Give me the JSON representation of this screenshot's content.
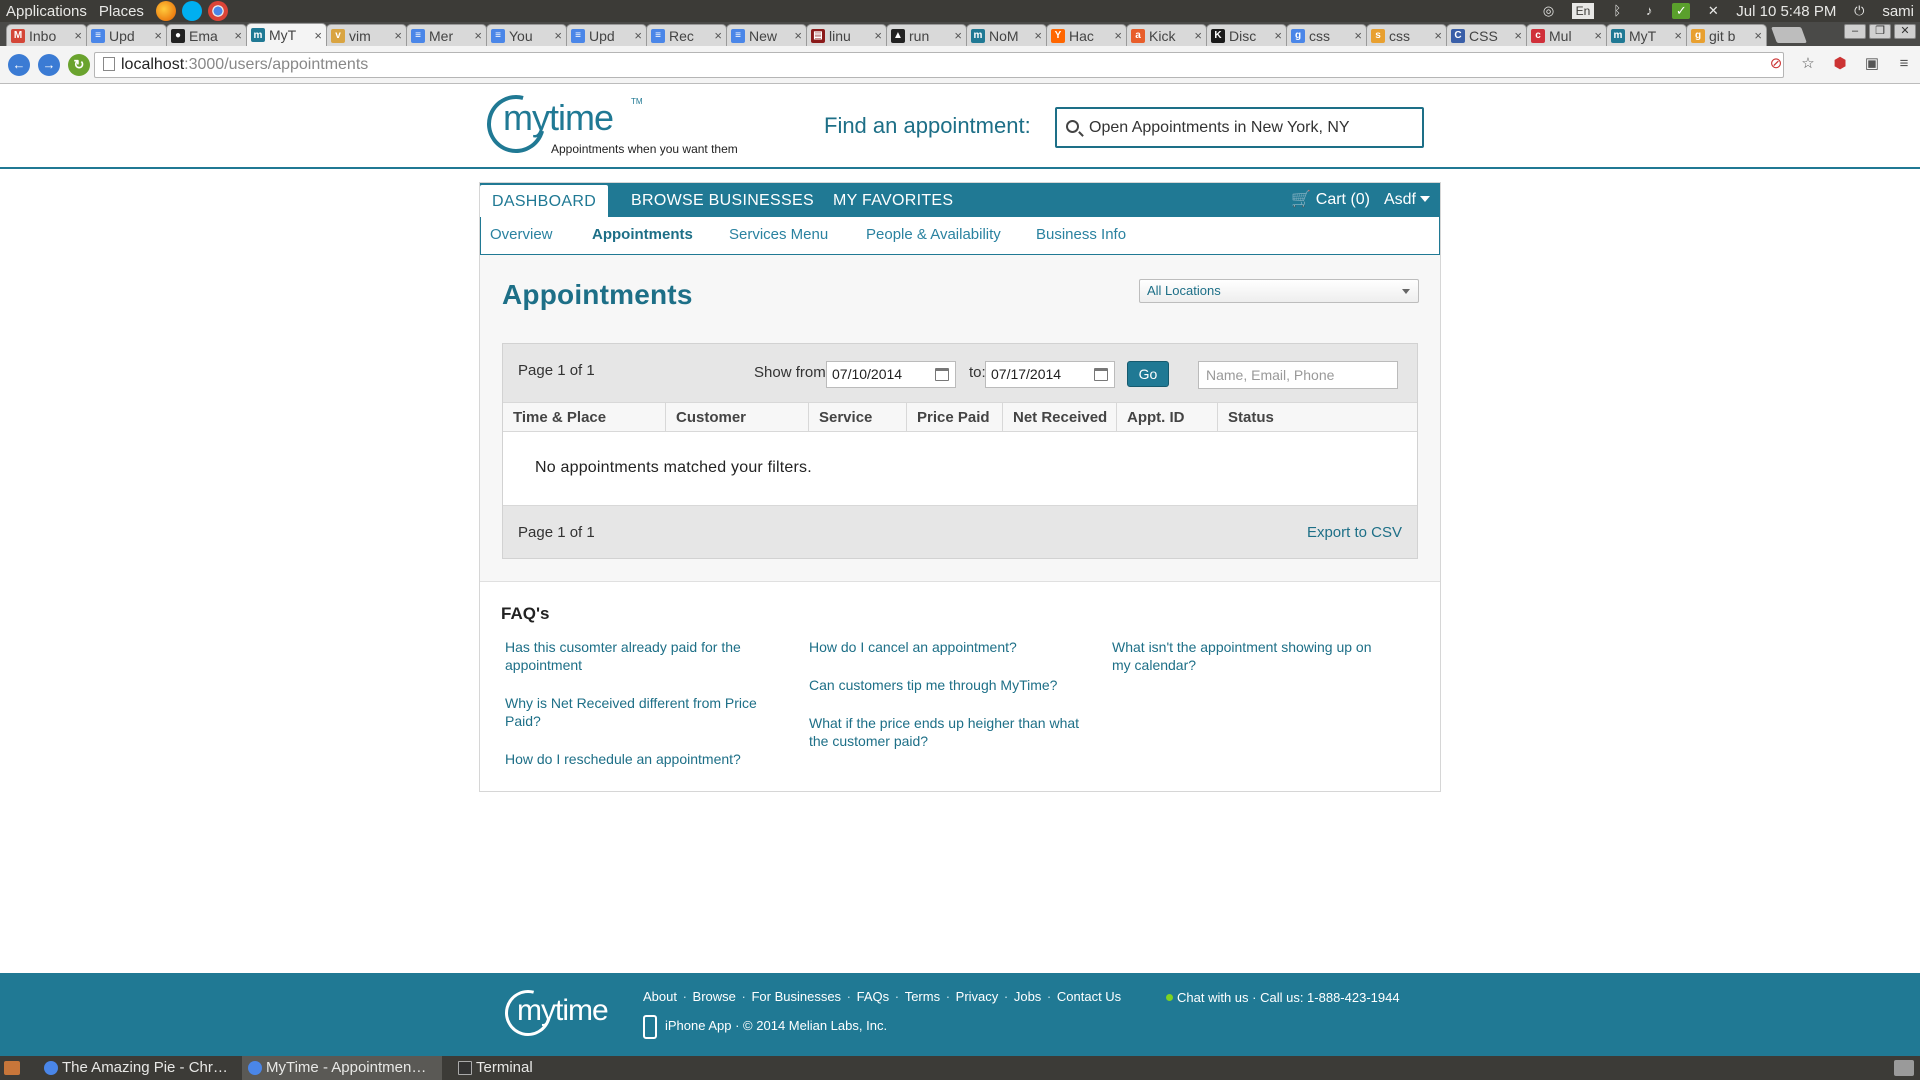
{
  "os": {
    "menu_applications": "Applications",
    "menu_places": "Places",
    "lang": "En",
    "clock": "Jul 10  5:48 PM",
    "user": "sami"
  },
  "browser": {
    "tabs": [
      {
        "label": "Inbo",
        "color": "#d44638",
        "glyph": "M"
      },
      {
        "label": "Upd",
        "color": "#4a86e8",
        "glyph": "≡"
      },
      {
        "label": "Ema",
        "color": "#222222",
        "glyph": "●"
      },
      {
        "label": "MyT",
        "color": "#207994",
        "glyph": "m"
      },
      {
        "label": "vim",
        "color": "#d9a441",
        "glyph": "v"
      },
      {
        "label": "Mer",
        "color": "#4a86e8",
        "glyph": "≡"
      },
      {
        "label": "You",
        "color": "#4a86e8",
        "glyph": "≡"
      },
      {
        "label": "Upd",
        "color": "#4a86e8",
        "glyph": "≡"
      },
      {
        "label": "Rec",
        "color": "#4a86e8",
        "glyph": "≡"
      },
      {
        "label": "New",
        "color": "#4a86e8",
        "glyph": "≡"
      },
      {
        "label": "linu",
        "color": "#8b1a1a",
        "glyph": "▤"
      },
      {
        "label": "run",
        "color": "#222222",
        "glyph": "▲"
      },
      {
        "label": "NoM",
        "color": "#207994",
        "glyph": "m"
      },
      {
        "label": "Hac",
        "color": "#ff6600",
        "glyph": "Y"
      },
      {
        "label": "Kick",
        "color": "#e85d2a",
        "glyph": "a"
      },
      {
        "label": "Disc",
        "color": "#1a1a1a",
        "glyph": "K"
      },
      {
        "label": "css",
        "color": "#4a86e8",
        "glyph": "g"
      },
      {
        "label": "css",
        "color": "#e8a030",
        "glyph": "s"
      },
      {
        "label": "CSS",
        "color": "#3a5fa8",
        "glyph": "C"
      },
      {
        "label": "Mul",
        "color": "#d0303a",
        "glyph": "c"
      },
      {
        "label": "MyT",
        "color": "#207994",
        "glyph": "m"
      },
      {
        "label": "git b",
        "color": "#e8a030",
        "glyph": "g"
      }
    ],
    "active_tab": 3,
    "url_host": "localhost",
    "url_path": ":3000/users/appointments"
  },
  "header": {
    "logo_word": "mytime",
    "logo_tm": "TM",
    "logo_tagline": "Appointments when you want them",
    "find_label": "Find an appointment:",
    "find_value": "Open Appointments in New York, NY"
  },
  "mainnav": {
    "items": [
      "DASHBOARD",
      "BROWSE BUSINESSES",
      "MY FAVORITES"
    ],
    "cart": "Cart (0)",
    "user": "Asdf"
  },
  "subnav": {
    "items": [
      "Overview",
      "Appointments",
      "Services Menu",
      "People & Availability",
      "Business Info"
    ],
    "active": 1
  },
  "appointments": {
    "title": "Appointments",
    "location_select": "All Locations",
    "page_info_top": "Page 1 of 1",
    "show_from_label": "Show from",
    "from_date": "07/10/2014",
    "to_label": "to:",
    "to_date": "07/17/2014",
    "go_label": "Go",
    "search_placeholder": "Name, Email, Phone",
    "columns": [
      "Time & Place",
      "Customer",
      "Service",
      "Price Paid",
      "Net Received",
      "Appt. ID",
      "Status"
    ],
    "empty_message": "No appointments matched your filters.",
    "page_info_bottom": "Page 1 of 1",
    "export_label": "Export to CSV"
  },
  "faq": {
    "title": "FAQ's",
    "col1": [
      "Has this cusomter already paid for the appointment",
      "Why is Net Received different from Price Paid?",
      "How do I reschedule an appointment?"
    ],
    "col2": [
      "How do I cancel an appointment?",
      "Can customers tip me through MyTime?",
      "What if the price ends up heigher than what the customer paid?"
    ],
    "col3": [
      "What isn't the appointment showing up on my calendar?"
    ]
  },
  "footer": {
    "logo_word": "mytime",
    "links": [
      "About",
      "Browse",
      "For Businesses",
      "FAQs",
      "Terms",
      "Privacy",
      "Jobs",
      "Contact Us"
    ],
    "app_line": "iPhone App · © 2014 Melian Labs, Inc.",
    "chat_line": "Chat with us · Call us: 1-888-423-1944"
  },
  "taskbar": {
    "items": [
      "The Amazing Pie - Chr…",
      "MyTime - Appointmen…",
      "Terminal"
    ]
  }
}
